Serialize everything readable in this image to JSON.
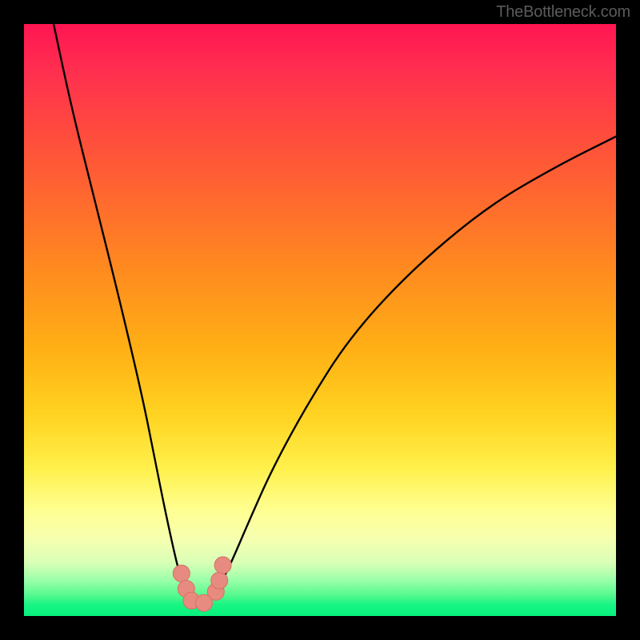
{
  "watermark": {
    "text": "TheBottleneck.com"
  },
  "colors": {
    "frame": "#000000",
    "gradient_top": "#ff1552",
    "gradient_mid": "#ffd321",
    "gradient_bottom": "#07f07e",
    "curve_stroke": "#000000",
    "marker_fill": "#e78a7f",
    "marker_stroke": "#d96f63",
    "watermark": "#5b5b5b"
  },
  "chart_data": {
    "type": "line",
    "title": "",
    "xlabel": "",
    "ylabel": "",
    "xlim": [
      0,
      100
    ],
    "ylim": [
      0,
      100
    ],
    "grid": false,
    "legend": false,
    "series": [
      {
        "name": "bottleneck-curve",
        "x": [
          5,
          8,
          12,
          16,
          20,
          22,
          24,
          26,
          27,
          28,
          29,
          30,
          31,
          33,
          35,
          38,
          42,
          48,
          55,
          65,
          78,
          90,
          100
        ],
        "y": [
          100,
          86,
          70,
          54,
          37,
          27,
          17,
          8,
          5,
          3,
          2,
          2,
          3,
          5,
          9,
          16,
          25,
          36,
          47,
          58,
          69,
          76,
          81
        ]
      }
    ],
    "markers": [
      {
        "x": 26.6,
        "y": 7.2
      },
      {
        "x": 27.4,
        "y": 4.6
      },
      {
        "x": 28.3,
        "y": 2.6
      },
      {
        "x": 30.4,
        "y": 2.2
      },
      {
        "x": 32.4,
        "y": 4.1
      },
      {
        "x": 33.0,
        "y": 6.0
      },
      {
        "x": 33.6,
        "y": 8.6
      }
    ]
  }
}
